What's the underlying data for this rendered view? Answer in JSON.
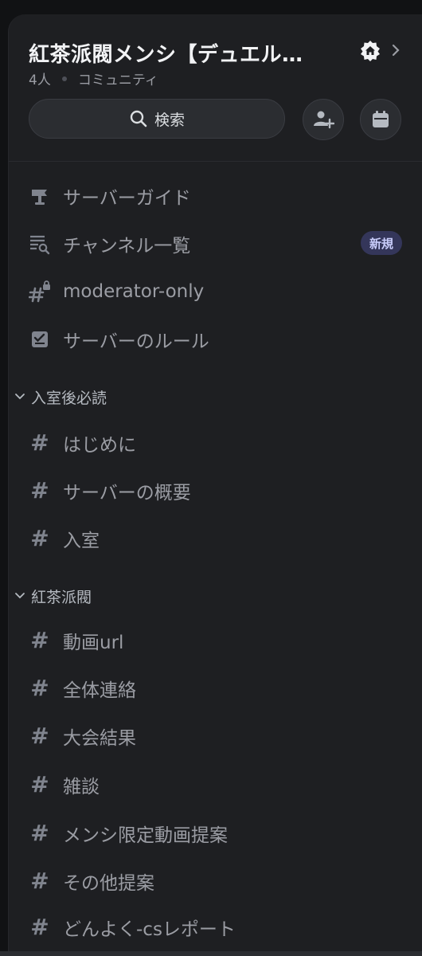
{
  "header": {
    "server_name": "紅茶派閥メンシ【デュエル…",
    "member_count": "4人",
    "server_type": "コミュニティ",
    "search_label": "検索"
  },
  "top_channels": [
    {
      "label": "サーバーガイド",
      "icon": "signpost-icon"
    },
    {
      "label": "チャンネル一覧",
      "icon": "channel-browse-icon",
      "badge": "新規"
    },
    {
      "label": "moderator-only",
      "icon": "locked-hash-icon"
    },
    {
      "label": "サーバーのルール",
      "icon": "rules-check-icon"
    }
  ],
  "categories": [
    {
      "name": "入室後必読",
      "channels": [
        "はじめに",
        "サーバーの概要",
        "入室"
      ]
    },
    {
      "name": "紅茶派閥",
      "channels": [
        "動画url",
        "全体連絡",
        "大会結果",
        "雑談",
        "メンシ限定動画提案",
        "その他提案",
        "どんよく-csレポート"
      ]
    }
  ],
  "colors": {
    "background": "#1e1f22",
    "channel_text": "#9b9da4",
    "new_badge_bg": "#34365a",
    "new_badge_text": "#c9cdfb"
  }
}
